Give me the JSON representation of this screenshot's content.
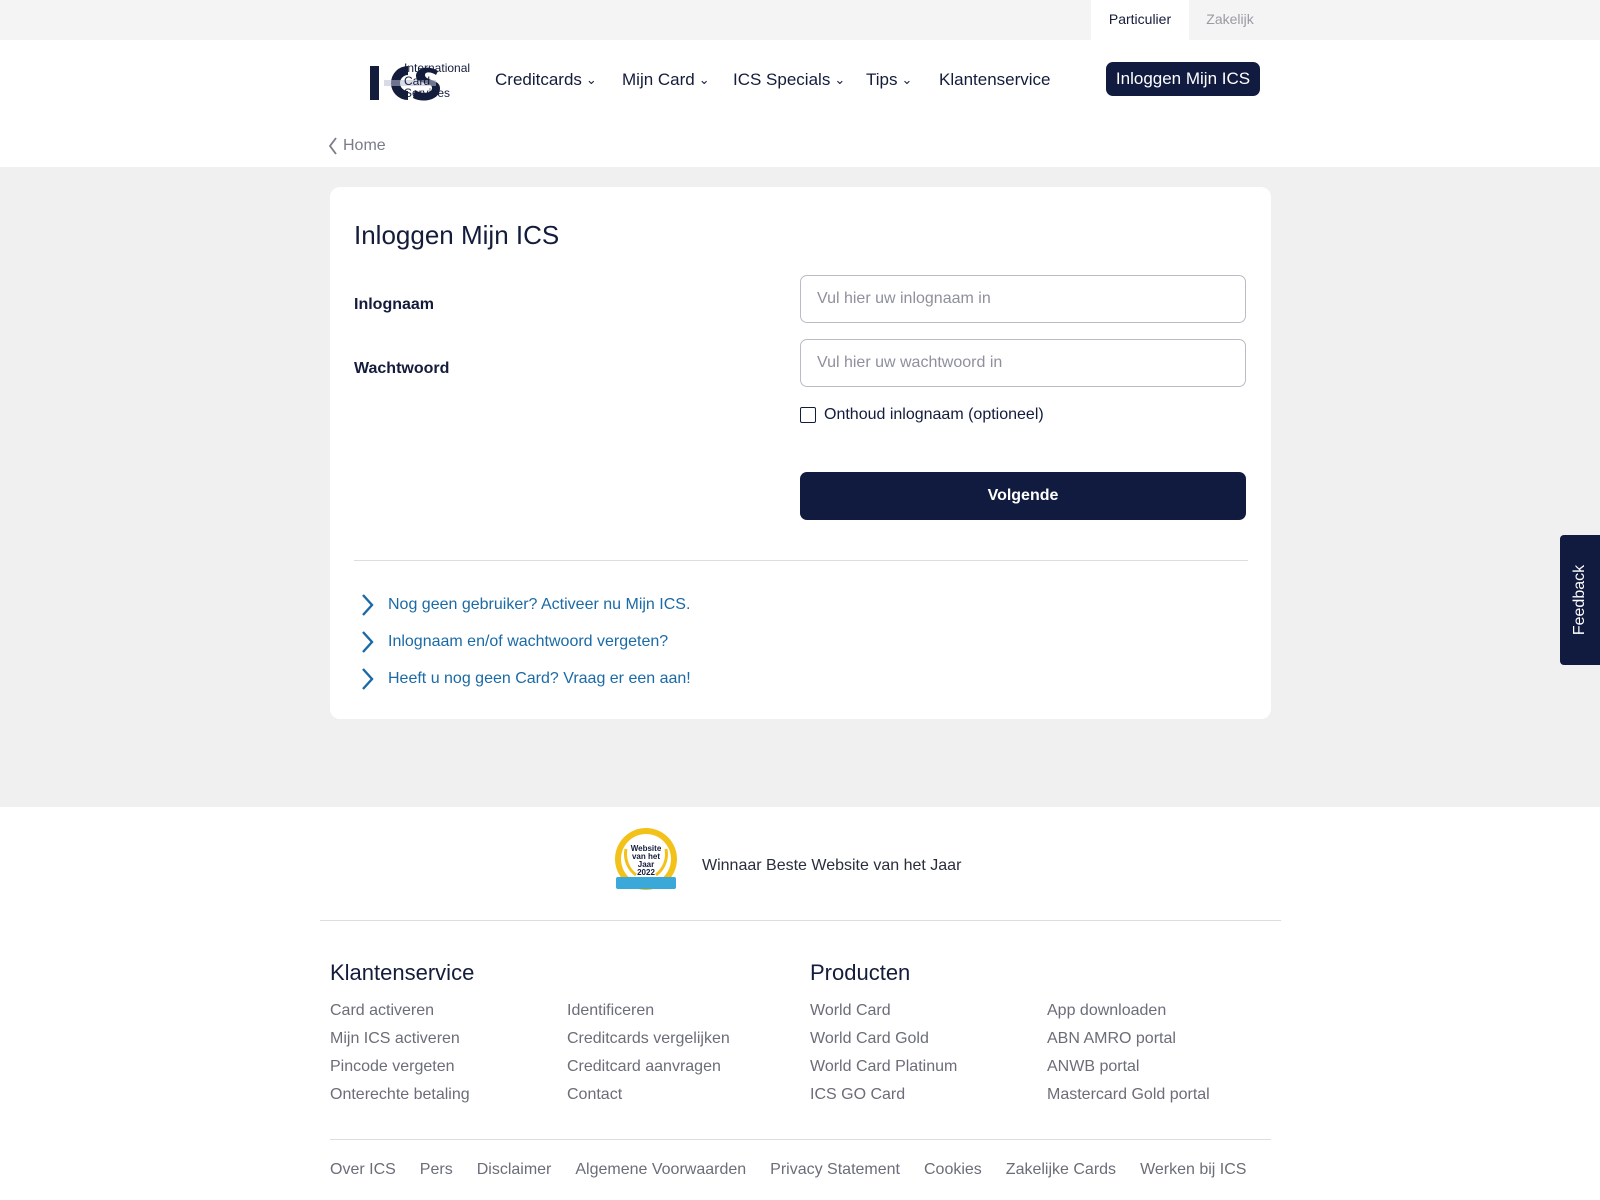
{
  "segments": {
    "active": "Particulier",
    "inactive": "Zakelijk"
  },
  "logo": {
    "line1": "International",
    "line2": "Card",
    "line3": "Services"
  },
  "nav": {
    "items": [
      {
        "label": "Creditcards",
        "chevron": "⌄"
      },
      {
        "label": "Mijn Card",
        "chevron": "⌄"
      },
      {
        "label": "ICS Specials",
        "chevron": "⌄"
      },
      {
        "label": "Tips",
        "chevron": "⌄"
      },
      {
        "label": "Klantenservice"
      }
    ],
    "login_button": "Inloggen Mijn ICS"
  },
  "breadcrumb": {
    "label": "Home"
  },
  "login_form": {
    "title": "Inloggen Mijn ICS",
    "username_label": "Inlognaam",
    "username_placeholder": "Vul hier uw inlognaam in",
    "password_label": "Wachtwoord",
    "password_placeholder": "Vul hier uw wachtwoord in",
    "remember_label": "Onthoud inlognaam (optioneel)",
    "remember_checked": false,
    "submit_label": "Volgende",
    "help_links": [
      "Nog geen gebruiker? Activeer nu Mijn ICS.",
      "Inlognaam en/of wachtwoord vergeten?",
      "Heeft u nog geen Card? Vraag er een aan!"
    ]
  },
  "award": {
    "badge_lines": [
      "Website",
      "van het",
      "Jaar",
      "2022"
    ],
    "text": "Winnaar Beste Website van het Jaar"
  },
  "footer": {
    "klantenservice": {
      "title": "Klantenservice",
      "col1": [
        "Card activeren",
        "Mijn ICS activeren",
        "Pincode vergeten",
        "Onterechte betaling"
      ],
      "col2": [
        "Identificeren",
        "Creditcards vergelijken",
        "Creditcard aanvragen",
        "Contact"
      ]
    },
    "producten": {
      "title": "Producten",
      "col1": [
        "World Card",
        "World Card Gold",
        "World Card Platinum",
        "ICS GO Card"
      ],
      "col2": [
        "App downloaden",
        "ABN AMRO portal",
        "ANWB portal",
        "Mastercard Gold portal"
      ]
    },
    "bottom_links": [
      "Over ICS",
      "Pers",
      "Disclaimer",
      "Algemene Voorwaarden",
      "Privacy Statement",
      "Cookies",
      "Zakelijke Cards",
      "Werken bij ICS"
    ]
  },
  "feedback": {
    "label": "Feedback"
  },
  "colors": {
    "navy": "#111a3f",
    "link_blue": "#1a6aa6",
    "band_grey": "#f0f0f1",
    "award_gold": "#f2c21a",
    "award_blue": "#3aa8d8"
  }
}
